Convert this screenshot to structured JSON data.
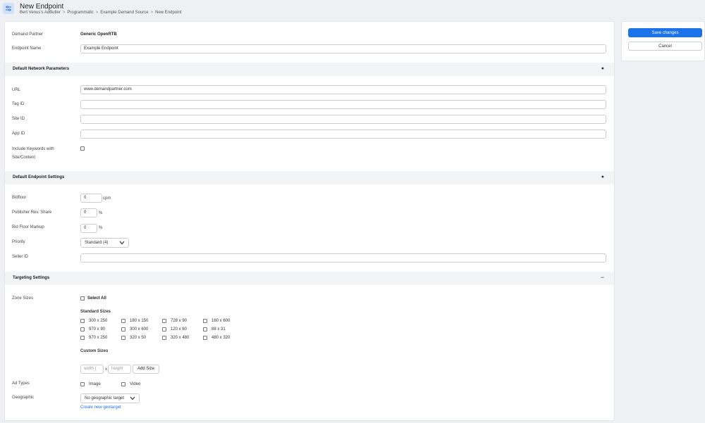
{
  "header": {
    "icon": "sliders-icon",
    "title": "New Endpoint",
    "breadcrumb": [
      "Bert Venus's AdButler",
      "Programmatic",
      "Example Demand Source",
      "New Endpoint"
    ]
  },
  "actions": {
    "save_label": "Save changes",
    "cancel_label": "Cancel"
  },
  "form": {
    "demand_partner_label": "Demand Partner",
    "demand_partner_value": "Generic OpenRTB",
    "endpoint_name_label": "Endpoint Name",
    "endpoint_name_value": "Example Endpoint"
  },
  "network": {
    "title": "Default Network Parameters",
    "url_label": "URL",
    "url_value": "www.demandpartner.com",
    "tag_label": "Tag ID",
    "site_label": "Site ID",
    "app_label": "App ID",
    "keywords_label_1": "Include Keywords with",
    "keywords_label_2": "Site/Content"
  },
  "endpoint": {
    "title": "Default Endpoint Settings",
    "bidfloor_label": "Bidfloor",
    "bidfloor_value": "0",
    "bidfloor_unit": "cpm",
    "rev_share_label": "Publisher Rev. Share",
    "rev_share_value": "0",
    "rev_share_unit": "%",
    "markup_label": "Bid Floor Markup",
    "markup_value": "0",
    "markup_unit": "%",
    "priority_label": "Priority",
    "priority_value": "Standard (4)",
    "seller_label": "Seller ID"
  },
  "targeting": {
    "title": "Targeting Settings",
    "zone_sizes_label": "Zone Sizes",
    "select_all": "Select All",
    "standard_sizes": "Standard Sizes",
    "sizes": [
      "300 x 250",
      "180 x 150",
      "728 x 90",
      "160 x 600",
      "970 x 90",
      "300 x 600",
      "120 x 60",
      "88 x 31",
      "970 x 250",
      "320 x 50",
      "320 x 480",
      "480 x 320"
    ],
    "custom_sizes": "Custom Sizes",
    "width_placeholder": "width (",
    "x_sep": "x",
    "height_placeholder": "height",
    "add_size": "Add Size",
    "ad_types_label": "Ad Types",
    "ad_type_image": "Image",
    "ad_type_video": "Video",
    "geo_label": "Geographic",
    "geo_value": "No geographic target",
    "geo_link": "Create new geotarget"
  }
}
